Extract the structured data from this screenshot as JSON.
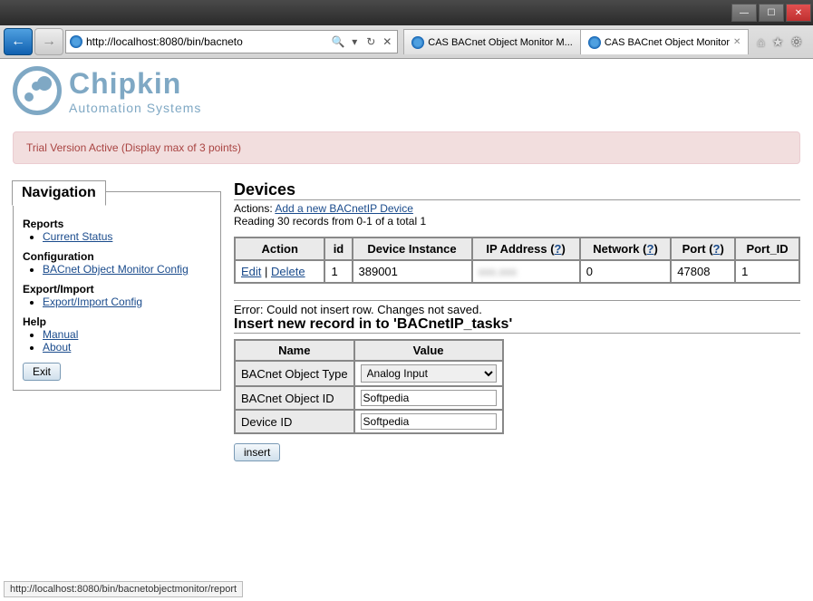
{
  "window": {
    "url": "http://localhost:8080/bin/bacneto",
    "tabs": [
      {
        "label": "CAS BACnet Object Monitor M...",
        "active": false
      },
      {
        "label": "CAS BACnet Object Monitor",
        "active": true
      }
    ],
    "status_url": "http://localhost:8080/bin/bacnetobjectmonitor/report"
  },
  "logo": {
    "line1": "Chipkin",
    "line2": "Automation Systems"
  },
  "alert": "Trial Version Active (Display max of 3 points)",
  "nav": {
    "title": "Navigation",
    "sections": [
      {
        "heading": "Reports",
        "items": [
          "Current Status"
        ]
      },
      {
        "heading": "Configuration",
        "items": [
          "BACnet Object Monitor Config"
        ]
      },
      {
        "heading": "Export/Import",
        "items": [
          "Export/Import Config"
        ]
      },
      {
        "heading": "Help",
        "items": [
          "Manual",
          "About"
        ]
      }
    ],
    "exit_label": "Exit"
  },
  "devices": {
    "heading": "Devices",
    "actions_label": "Actions:",
    "add_link": "Add a new BACnetIP Device",
    "reading": "Reading 30 records from 0-1 of a total 1",
    "columns": [
      "Action",
      "id",
      "Device Instance",
      "IP Address (?)",
      "Network (?)",
      "Port (?)",
      "Port_ID"
    ],
    "row": {
      "edit": "Edit",
      "sep": " | ",
      "delete": "Delete",
      "id": "1",
      "instance": "389001",
      "ip": "xxx.xxx",
      "network": "0",
      "port": "47808",
      "port_id": "1"
    }
  },
  "error_text": "Error: Could not insert row. Changes not saved.",
  "insert": {
    "heading": "Insert new record in to 'BACnetIP_tasks'",
    "col_name": "Name",
    "col_value": "Value",
    "rows": [
      {
        "label": "BACnet Object Type",
        "type": "select",
        "value": "Analog Input"
      },
      {
        "label": "BACnet Object ID",
        "type": "text",
        "value": "Softpedia"
      },
      {
        "label": "Device ID",
        "type": "text",
        "value": "Softpedia"
      }
    ],
    "button": "insert"
  }
}
